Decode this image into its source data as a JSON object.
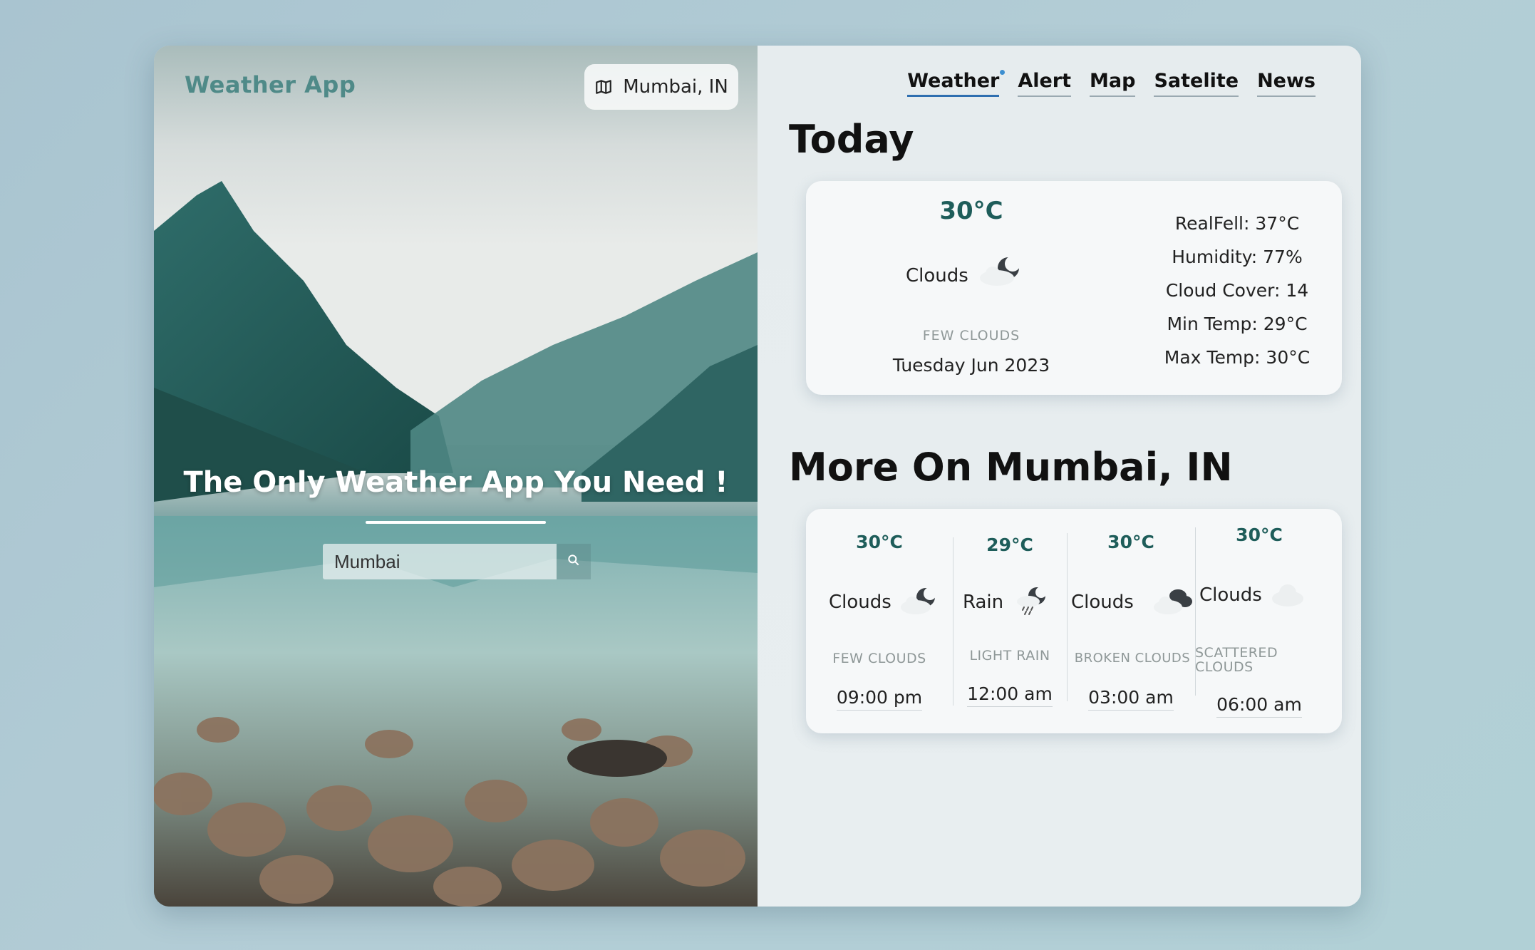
{
  "brand": "Weather App",
  "location_chip": {
    "label": "Mumbai, IN",
    "icon": "map-icon"
  },
  "hero": {
    "headline": "The Only Weather App You Need !"
  },
  "search": {
    "value": "Mumbai",
    "icon": "search-icon"
  },
  "nav": [
    {
      "label": "Weather",
      "active": true
    },
    {
      "label": "Alert"
    },
    {
      "label": "Map"
    },
    {
      "label": "Satelite"
    },
    {
      "label": "News"
    }
  ],
  "today": {
    "title": "Today",
    "temp": "30°C",
    "condition": "Clouds",
    "description": "FEW CLOUDS",
    "date": "Tuesday Jun 2023",
    "stats": [
      "RealFell: 37°C",
      "Humidity: 77%",
      "Cloud Cover: 14",
      "Min Temp: 29°C",
      "Max Temp: 30°C"
    ]
  },
  "more": {
    "title": "More On Mumbai, IN",
    "forecast": [
      {
        "temp": "30°C",
        "condition": "Clouds",
        "description": "FEW CLOUDS",
        "time": "09:00 pm",
        "icon": "partly-cloudy-night-icon"
      },
      {
        "temp": "29°C",
        "condition": "Rain",
        "description": "LIGHT RAIN",
        "time": "12:00 am",
        "icon": "rain-night-icon"
      },
      {
        "temp": "30°C",
        "condition": "Clouds",
        "description": "BROKEN CLOUDS",
        "time": "03:00 am",
        "icon": "broken-clouds-icon"
      },
      {
        "temp": "30°C",
        "condition": "Clouds",
        "description": "SCATTERED CLOUDS",
        "time": "06:00 am",
        "icon": "scattered-clouds-icon"
      }
    ]
  },
  "colors": {
    "accent": "#1e5d5a",
    "brand": "#4f8a88",
    "nav_active": "#2f6fb0"
  }
}
